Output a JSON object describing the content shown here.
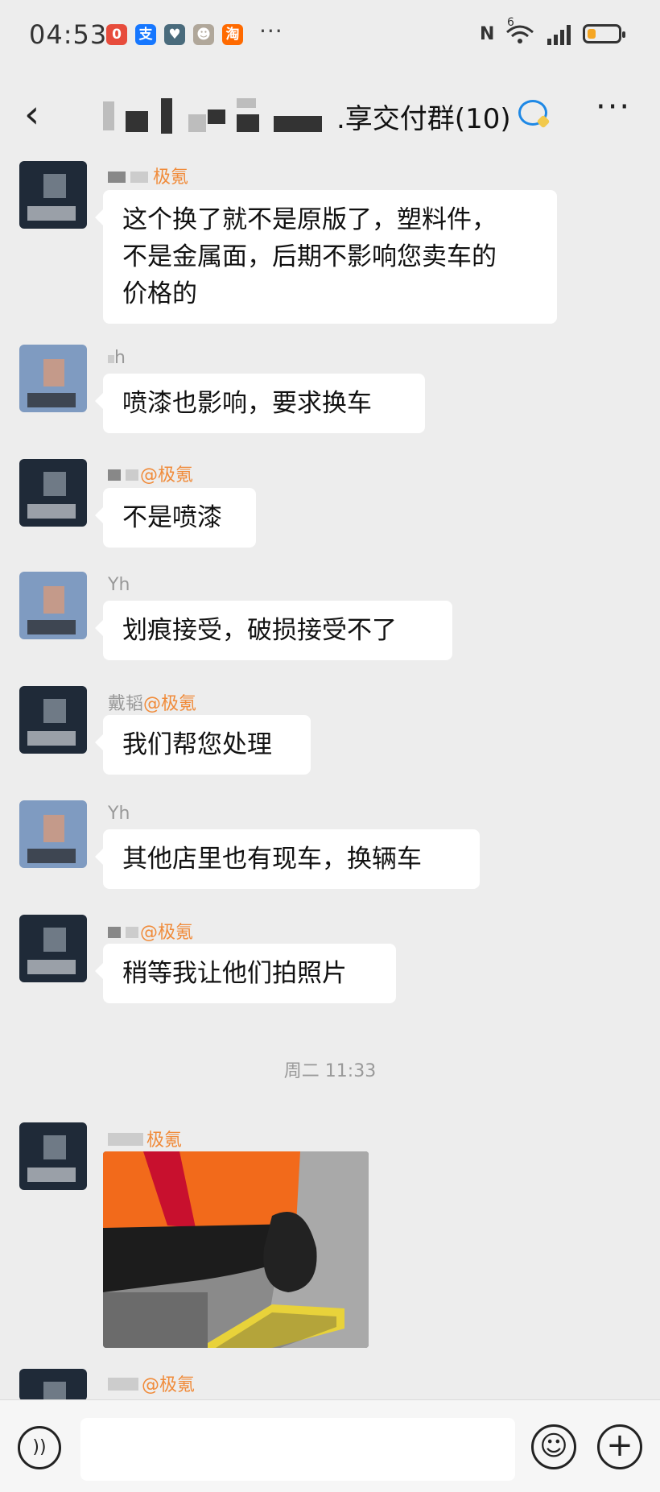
{
  "status_bar": {
    "time": "04:53",
    "app_icons": [
      {
        "name": "notify-red-icon",
        "glyph": "0",
        "color": "#e74c3c"
      },
      {
        "name": "alipay-icon",
        "glyph": "支",
        "color": "#1677ff"
      },
      {
        "name": "heart-app-icon",
        "glyph": "♥",
        "color": "#4a6b7c"
      },
      {
        "name": "robot-app-icon",
        "glyph": "☻",
        "color": "#b0a79a"
      },
      {
        "name": "taobao-icon",
        "glyph": "淘",
        "color": "#ff6a00"
      }
    ],
    "more": "···",
    "nfc": "N",
    "wifi": "6",
    "signal": "ıll",
    "battery_level": 0.28
  },
  "header": {
    "back_icon": "‹",
    "title": ".享交付群(10)",
    "more_icon": "···"
  },
  "messages": [
    {
      "sender_prefix": "",
      "sender_org": "极氪",
      "text_lines": [
        "这个换了就不是原版了，塑料件，",
        "不是金属面，后期不影响您卖车的",
        "价格的"
      ]
    },
    {
      "sender_prefix": "h",
      "sender_org": "",
      "text_lines": [
        "喷漆也影响，要求换车"
      ]
    },
    {
      "sender_prefix": "",
      "sender_org": "@极氪",
      "text_lines": [
        "不是喷漆"
      ]
    },
    {
      "sender_prefix": "Yh",
      "sender_org": "",
      "text_lines": [
        "划痕接受，破损接受不了"
      ]
    },
    {
      "sender_prefix": "戴韬",
      "sender_org": "@极氪",
      "text_lines": [
        "我们帮您处理"
      ]
    },
    {
      "sender_prefix": "Yh",
      "sender_org": "",
      "text_lines": [
        "其他店里也有现车，换辆车"
      ]
    },
    {
      "sender_prefix": "",
      "sender_org": "@极氪",
      "text_lines": [
        "稍等我让他们拍照片"
      ]
    }
  ],
  "timestamp": "周二 11:33",
  "photo_message": {
    "sender_org": "极氪"
  },
  "last_message": {
    "sender_org": "@极氪"
  },
  "composer": {
    "voice_icon": "))",
    "placeholder": "",
    "emoji_icon": "☺",
    "plus_icon": "+"
  }
}
